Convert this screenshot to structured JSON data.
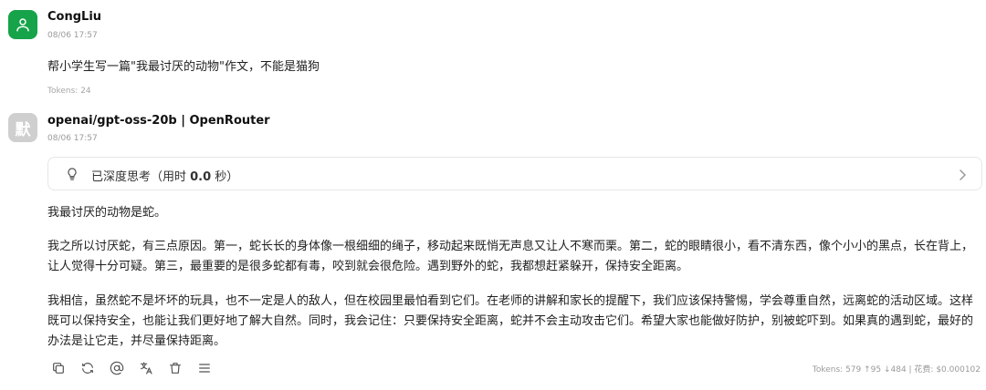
{
  "user_message": {
    "name": "CongLiu",
    "time": "08/06 17:57",
    "text": "帮小学生写一篇\"我最讨厌的动物\"作文，不能是猫狗",
    "tokens": "Tokens: 24"
  },
  "assistant_message": {
    "avatar_char": "默",
    "name": "openai/gpt-oss-20b | OpenRouter",
    "time": "08/06 17:57",
    "thinking": {
      "label_prefix": "已深度思考（用时 ",
      "seconds": "0.0",
      "label_suffix": " 秒）"
    },
    "paragraphs": [
      "我最讨厌的动物是蛇。",
      "我之所以讨厌蛇，有三点原因。第一，蛇长长的身体像一根细细的绳子，移动起来既悄无声息又让人不寒而栗。第二，蛇的眼睛很小，看不清东西，像个小小的黑点，长在背上，让人觉得十分可疑。第三，最重要的是很多蛇都有毒，咬到就会很危险。遇到野外的蛇，我都想赶紧躲开，保持安全距离。",
      "我相信，虽然蛇不是坏坏的玩具，也不一定是人的敌人，但在校园里最怕看到它们。在老师的讲解和家长的提醒下，我们应该保持警惕，学会尊重自然，远离蛇的活动区域。这样既可以保持安全，也能让我们更好地了解大自然。同时，我会记住：只要保持安全距离，蛇并不会主动攻击它们。希望大家也能做好防护，别被蛇吓到。如果真的遇到蛇，最好的办法是让它走，并尽量保持距离。"
    ],
    "stats": "Tokens: 579 ↑95 ↓484 | 花费: $0.000102",
    "toolbar_icons": [
      "copy-icon",
      "refresh-icon",
      "mention-icon",
      "translate-icon",
      "delete-icon",
      "menu-icon"
    ]
  },
  "colors": {
    "user_avatar": "#16a34a",
    "bot_avatar": "#cfcfcf"
  }
}
